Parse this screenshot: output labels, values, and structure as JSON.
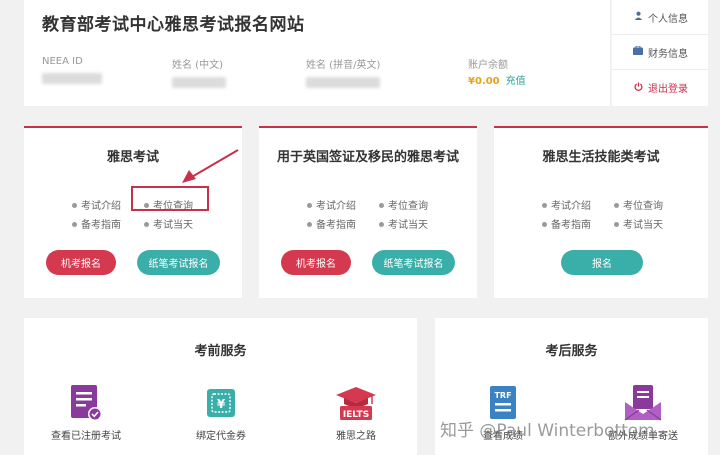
{
  "header": {
    "title": "教育部考试中心雅思考试报名网站",
    "neea_id_label": "NEEA ID",
    "name_cn_label": "姓名 (中文)",
    "name_en_label": "姓名 (拼音/英文)",
    "balance_label": "账户余额",
    "balance_value": "¥0.00",
    "recharge": "充值"
  },
  "side_menu": {
    "personal_info": "个人信息",
    "financial_info": "财务信息",
    "logout": "退出登录"
  },
  "cards": {
    "ielts": {
      "title": "雅思考试",
      "links": [
        "考试介绍",
        "考位查询",
        "备考指南",
        "考试当天"
      ],
      "buttons": [
        "机考报名",
        "纸笔考试报名"
      ]
    },
    "ukvi": {
      "title": "用于英国签证及移民的雅思考试",
      "links": [
        "考试介绍",
        "考位查询",
        "备考指南",
        "考试当天"
      ],
      "buttons": [
        "机考报名",
        "纸笔考试报名"
      ]
    },
    "life": {
      "title": "雅思生活技能类考试",
      "links": [
        "考试介绍",
        "考位查询",
        "备考指南",
        "考试当天"
      ],
      "buttons": [
        "报名"
      ]
    }
  },
  "pre_services": {
    "title": "考前服务",
    "items": [
      "查看已注册考试",
      "绑定代金券",
      "雅思之路"
    ]
  },
  "post_services": {
    "title": "考后服务",
    "items": [
      "查看成绩",
      "额外成绩单寄送"
    ]
  },
  "icon_text": {
    "voucher": "¥",
    "ielts_badge": "IELTS",
    "trf": "TRF"
  },
  "watermark": "知乎 @Paul Winterbottom",
  "colors": {
    "brand_red": "#d5394f",
    "teal": "#3aaea8",
    "balance": "#e8a21a"
  }
}
